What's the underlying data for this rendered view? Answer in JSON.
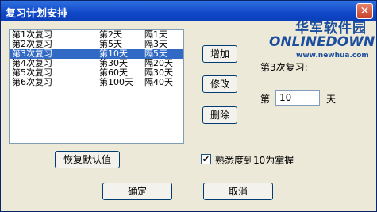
{
  "window": {
    "title": "复习计划安排",
    "close_glyph": "✕"
  },
  "list": {
    "rows": [
      {
        "name": "第1次复习",
        "day": "第2天",
        "interval": "隔1天",
        "selected": false
      },
      {
        "name": "第2次复习",
        "day": "第5天",
        "interval": "隔3天",
        "selected": false
      },
      {
        "name": "第3次复习",
        "day": "第10天",
        "interval": "隔5天",
        "selected": true
      },
      {
        "name": "第4次复习",
        "day": "第30天",
        "interval": "隔20天",
        "selected": false
      },
      {
        "name": "第5次复习",
        "day": "第60天",
        "interval": "隔30天",
        "selected": false
      },
      {
        "name": "第6次复习",
        "day": "第100天",
        "interval": "隔40天",
        "selected": false
      }
    ]
  },
  "buttons": {
    "add": "增加",
    "modify": "修改",
    "delete": "删除",
    "restore_default": "恢复默认值",
    "ok": "确定",
    "cancel": "取消"
  },
  "detail": {
    "heading": "第3次复习:",
    "day_prefix": "第",
    "day_value": "10",
    "day_suffix": "天"
  },
  "checkbox": {
    "label": "熟悉度到10为掌握",
    "checked": true,
    "mark": "✔"
  },
  "watermark": {
    "cn": "华军软件园",
    "en": "ONLINEDOWN",
    "url": "www.newhua.com"
  },
  "colors": {
    "title_bar": "#0f47c8",
    "selection": "#316ac5",
    "dialog_bg": "#ece9d8"
  }
}
